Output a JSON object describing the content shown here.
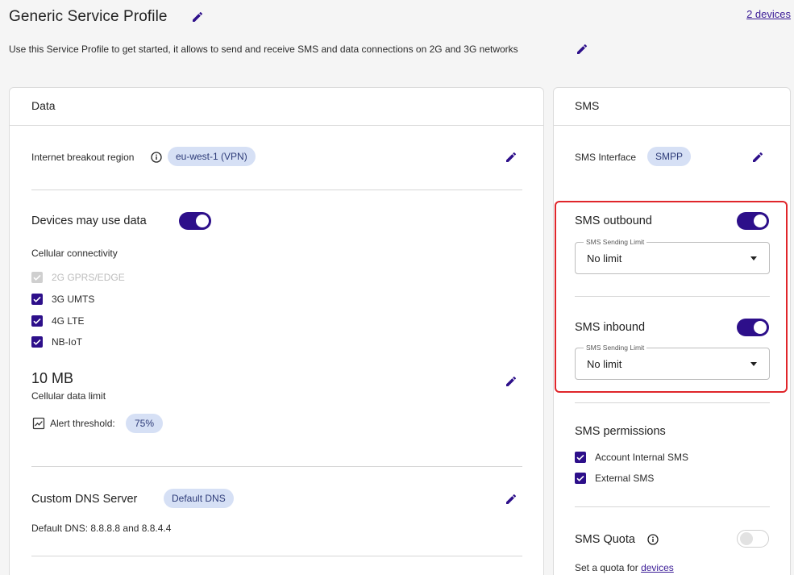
{
  "header": {
    "title": "Generic Service Profile",
    "devices_link": "2 devices",
    "description": "Use this Service Profile to get started, it allows to send and receive SMS and data connections on 2G and 3G networks"
  },
  "data_card": {
    "title": "Data",
    "breakout_label": "Internet breakout region",
    "breakout_value": "eu-west-1 (VPN)",
    "devices_may_use_data": "Devices may use data",
    "devices_may_use_data_on": true,
    "cellular_connectivity": "Cellular connectivity",
    "connectivity_options": [
      {
        "label": "2G GPRS/EDGE",
        "checked": true,
        "disabled": true
      },
      {
        "label": "3G UMTS",
        "checked": true,
        "disabled": false
      },
      {
        "label": "4G LTE",
        "checked": true,
        "disabled": false
      },
      {
        "label": "NB-IoT",
        "checked": true,
        "disabled": false
      }
    ],
    "data_limit_value": "10 MB",
    "data_limit_label": "Cellular data limit",
    "alert_threshold_label": "Alert threshold:",
    "alert_threshold_value": "75%",
    "dns_title": "Custom DNS Server",
    "dns_chip": "Default DNS",
    "dns_detail": "Default DNS: 8.8.8.8 and 8.8.4.4"
  },
  "sms_card": {
    "title": "SMS",
    "interface_label": "SMS Interface",
    "interface_value": "SMPP",
    "outbound_title": "SMS outbound",
    "outbound_on": true,
    "outbound_limit_legend": "SMS Sending Limit",
    "outbound_limit_value": "No limit",
    "inbound_title": "SMS inbound",
    "inbound_on": true,
    "inbound_limit_legend": "SMS Sending Limit",
    "inbound_limit_value": "No limit",
    "permissions_title": "SMS permissions",
    "permissions": [
      {
        "label": "Account Internal SMS",
        "checked": true
      },
      {
        "label": "External SMS",
        "checked": true
      }
    ],
    "quota_title": "SMS Quota",
    "quota_on": false,
    "quota_text_prefix": "Set a quota for",
    "quota_link": "devices"
  },
  "colors": {
    "accent": "#2d0f8a",
    "chip_bg": "#d6e0f5",
    "highlight": "#e0262b"
  }
}
